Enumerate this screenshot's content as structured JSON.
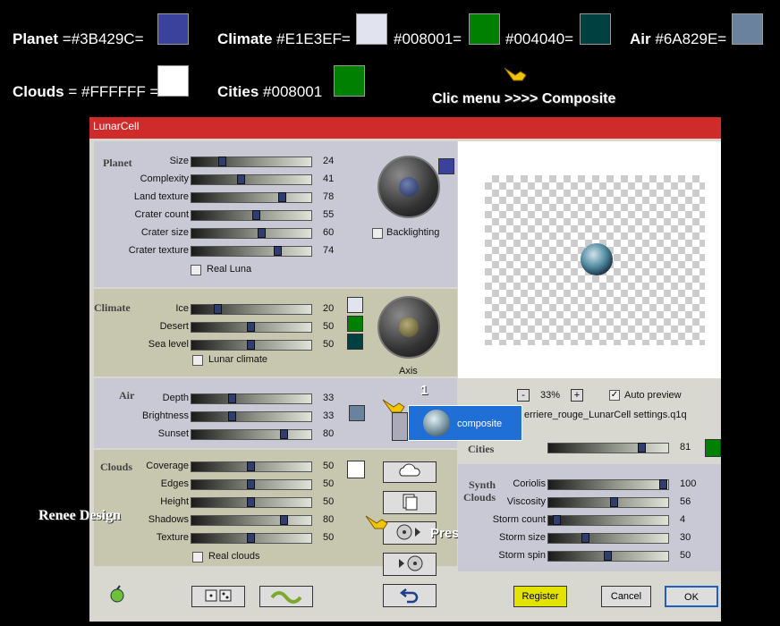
{
  "header": {
    "planet_label": "Planet",
    "planet_value": "=#3B429C=",
    "planet_color": "#3B429C",
    "climate_label": "Climate",
    "climate_value1": "#E1E3EF=",
    "climate_color1": "#E1E3EF",
    "climate_value2": "#008001=",
    "climate_color2": "#008001",
    "climate_value3": "#004040=",
    "climate_color3": "#004040",
    "air_label": "Air",
    "air_value": "#6A829E=",
    "air_color": "#6A829E",
    "clouds_label": "Clouds",
    "clouds_value": "= #FFFFFF =",
    "clouds_color": "#FFFFFF",
    "cities_label": "Cities",
    "cities_value": "#008001",
    "cities_color": "#008001",
    "hint": "Clic menu >>>> Composite"
  },
  "window": {
    "title": "LunarCell",
    "planet": {
      "label": "Planet",
      "color": "#3B429C",
      "rows": [
        {
          "label": "Size",
          "value": 24
        },
        {
          "label": "Complexity",
          "value": 41
        },
        {
          "label": "Land texture",
          "value": 78
        },
        {
          "label": "Crater count",
          "value": 55
        },
        {
          "label": "Crater size",
          "value": 60
        },
        {
          "label": "Crater texture",
          "value": 74
        }
      ],
      "checkbox": "Real Luna",
      "backlighting": "Backlighting"
    },
    "climate": {
      "label": "Climate",
      "rows": [
        {
          "label": "Ice",
          "value": 20
        },
        {
          "label": "Desert",
          "value": 50
        },
        {
          "label": "Sea level",
          "value": 50
        }
      ],
      "colors": [
        "#E1E3EF",
        "#008001",
        "#004040"
      ],
      "checkbox": "Lunar climate",
      "axis": "Axis"
    },
    "air": {
      "label": "Air",
      "color": "#6A829E",
      "rows": [
        {
          "label": "Depth",
          "value": 33
        },
        {
          "label": "Brightness",
          "value": 33
        },
        {
          "label": "Sunset",
          "value": 80
        }
      ]
    },
    "clouds": {
      "label": "Clouds",
      "color": "#FFFFFF",
      "rows": [
        {
          "label": "Coverage",
          "value": 50
        },
        {
          "label": "Edges",
          "value": 50
        },
        {
          "label": "Height",
          "value": 50
        },
        {
          "label": "Shadows",
          "value": 80
        },
        {
          "label": "Texture",
          "value": 50
        }
      ],
      "checkbox": "Real clouds"
    },
    "preview": {
      "zoom": "33%",
      "minus": "-",
      "plus": "+",
      "auto_preview": "Auto preview",
      "marker": "1",
      "settings_file": "erriere_rouge_LunarCell settings.q1q"
    },
    "cities": {
      "label": "Cities",
      "value": 81,
      "color": "#008001"
    },
    "synth": {
      "label_line1": "Synth",
      "label_line2": "Clouds",
      "rows": [
        {
          "label": "Coriolis",
          "value": 100
        },
        {
          "label": "Viscosity",
          "value": 56
        },
        {
          "label": "Storm count",
          "value": 4
        },
        {
          "label": "Storm size",
          "value": 30
        },
        {
          "label": "Storm spin",
          "value": 50
        }
      ]
    },
    "popup": {
      "item": "composite"
    },
    "preset_label": "Preset",
    "register": "Register",
    "cancel": "Cancel",
    "ok": "OK",
    "watermark": "Renee Design"
  }
}
